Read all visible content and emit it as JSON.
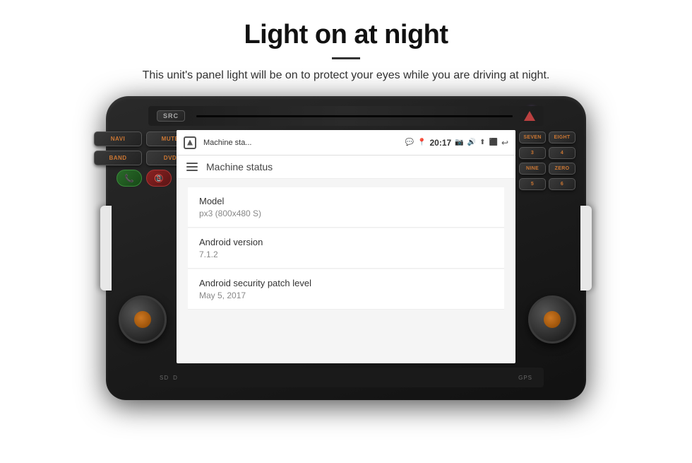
{
  "page": {
    "title": "Light on at night",
    "subtitle": "This unit's panel light will be on to protect your eyes while you are driving at night.",
    "divider": true
  },
  "unit": {
    "src_label": "SRC",
    "navi_label": "NAVI",
    "mute_label": "MUTE",
    "band_label": "BAND",
    "dvd_label": "DVD",
    "seven_label": "SEVEN",
    "eight_label": "EIGHT",
    "nine_label": "NINE",
    "zero_label": "ZERO",
    "sd_label": "SD",
    "d_label": "D",
    "gps_label": "GPS",
    "purple_dot": true
  },
  "android": {
    "status_bar": {
      "app_name": "Machine sta...",
      "time": "20:17",
      "icons": [
        "msg",
        "location",
        "photo",
        "volume",
        "cast",
        "screen",
        "back"
      ]
    },
    "app_header": {
      "title": "Machine status"
    },
    "items": [
      {
        "label": "Model",
        "value": "px3 (800x480 S)"
      },
      {
        "label": "Android version",
        "value": "7.1.2"
      },
      {
        "label": "Android security patch level",
        "value": "May 5, 2017"
      }
    ]
  }
}
